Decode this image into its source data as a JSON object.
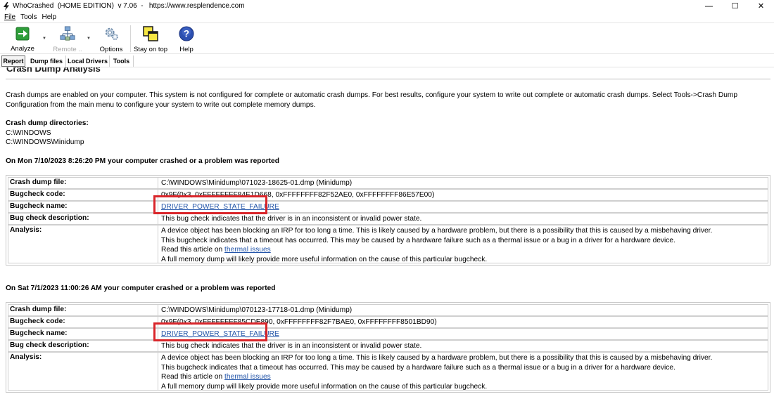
{
  "window": {
    "title": "WhoCrashed  (HOME EDITION)  v 7.06  -   https://www.resplendence.com",
    "minimize": "—",
    "maximize": "☐",
    "close": "✕"
  },
  "menu": [
    "File",
    "Tools",
    "Help"
  ],
  "toolbar": {
    "analyze": "Analyze",
    "remote": "Remote ..",
    "options": "Options",
    "stay_on_top": "Stay on top",
    "help": "Help"
  },
  "tabs": [
    "Report",
    "Dump files",
    "Local Drivers",
    "Tools"
  ],
  "report": {
    "heading": "Crash Dump Analysis",
    "paragraph": "Crash dumps are enabled on your computer. This system is not configured for complete or automatic crash dumps. For best results, configure your system to write out complete or automatic crash dumps. Select Tools->Crash Dump Configuration from the main menu to configure your system to write out complete memory dumps.",
    "dirs_label": "Crash dump directories:",
    "dirs": [
      "C:\\WINDOWS",
      "C:\\WINDOWS\\Minidump"
    ]
  },
  "labels": {
    "file": "Crash dump file:",
    "code": "Bugcheck code:",
    "name": "Bugcheck name:",
    "desc": "Bug check description:",
    "analysis": "Analysis:"
  },
  "crashes": [
    {
      "heading": "On Mon 7/10/2023 8:26:20 PM your computer crashed or a problem was reported",
      "file": "C:\\WINDOWS\\Minidump\\071023-18625-01.dmp (Minidump)",
      "code": "0x9F(0x3, 0xFFFFFFFF84E1D668, 0xFFFFFFFF82F52AE0, 0xFFFFFFFF86E57E00)",
      "name": "DRIVER_POWER_STATE_FAILURE",
      "desc": "This bug check indicates that the driver is in an inconsistent or invalid power state.",
      "analysis1": "A device object has been blocking an IRP for too long a time. This is likely caused by a hardware problem, but there is a possibility that this is caused by a misbehaving driver.",
      "analysis2": "This bugcheck indicates that a timeout has occurred. This may be caused by a hardware failure such as a thermal issue or a bug in a driver for a hardware device.",
      "analysis3_prefix": "Read this article on ",
      "analysis3_link": "thermal issues",
      "analysis4": "A full memory dump will likely provide more useful information on the cause of this particular bugcheck."
    },
    {
      "heading": "On Sat 7/1/2023 11:00:26 AM your computer crashed or a problem was reported",
      "file": "C:\\WINDOWS\\Minidump\\070123-17718-01.dmp (Minidump)",
      "code": "0x9F(0x3, 0xFFFFFFFF85CDE890, 0xFFFFFFFF82F7BAE0, 0xFFFFFFFF8501BD90)",
      "name": "DRIVER_POWER_STATE_FAILURE",
      "desc": "This bug check indicates that the driver is in an inconsistent or invalid power state.",
      "analysis1": "A device object has been blocking an IRP for too long a time. This is likely caused by a hardware problem, but there is a possibility that this is caused by a misbehaving driver.",
      "analysis2": "This bugcheck indicates that a timeout has occurred. This may be caused by a hardware failure such as a thermal issue or a bug in a driver for a hardware device.",
      "analysis3_prefix": "Read this article on ",
      "analysis3_link": "thermal issues",
      "analysis4": "A full memory dump will likely provide more useful information on the cause of this particular bugcheck."
    }
  ],
  "colors": {
    "highlight": "#d9252a",
    "link": "#2254a8"
  }
}
